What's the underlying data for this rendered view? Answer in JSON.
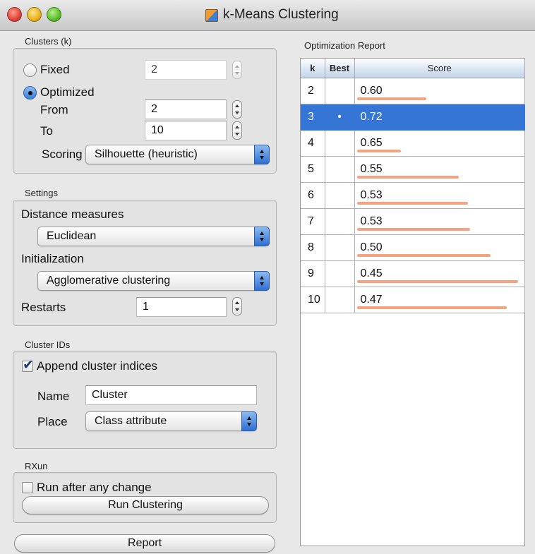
{
  "window": {
    "title": "k-Means Clustering"
  },
  "clusters": {
    "group_label": "Clusters (k)",
    "fixed_label": "Fixed",
    "fixed_value": "2",
    "optimized_label": "Optimized",
    "selected_mode": "Optimized",
    "from_label": "From",
    "from_value": "2",
    "to_label": "To",
    "to_value": "10",
    "scoring_label": "Scoring",
    "scoring_value": "Silhouette (heuristic)"
  },
  "settings": {
    "group_label": "Settings",
    "distance_label": "Distance measures",
    "distance_value": "Euclidean",
    "init_label": "Initialization",
    "init_value": "Agglomerative clustering",
    "restarts_label": "Restarts",
    "restarts_value": "1"
  },
  "cluster_ids": {
    "group_label": "Cluster IDs",
    "append_label": "Append cluster indices",
    "append_checked": true,
    "name_label": "Name",
    "name_value": "Cluster",
    "place_label": "Place",
    "place_value": "Class attribute"
  },
  "run": {
    "group_label": "RXun",
    "auto_label": "Run after any change",
    "auto_checked": false,
    "run_button": "Run Clustering"
  },
  "report_button": "Report",
  "optimization_report": {
    "label": "Optimization Report",
    "columns": [
      "k",
      "Best",
      "Score"
    ],
    "bar_color": "#f3a37f",
    "selected_color": "#3575d6",
    "rows": [
      {
        "k": "2",
        "best": "",
        "score": "0.60",
        "bar": 0.43,
        "selected": false
      },
      {
        "k": "3",
        "best": "•",
        "score": "0.72",
        "bar": 0.0,
        "selected": true
      },
      {
        "k": "4",
        "best": "",
        "score": "0.65",
        "bar": 0.27,
        "selected": false
      },
      {
        "k": "5",
        "best": "",
        "score": "0.55",
        "bar": 0.63,
        "selected": false
      },
      {
        "k": "6",
        "best": "",
        "score": "0.53",
        "bar": 0.69,
        "selected": false
      },
      {
        "k": "7",
        "best": "",
        "score": "0.53",
        "bar": 0.7,
        "selected": false
      },
      {
        "k": "8",
        "best": "",
        "score": "0.50",
        "bar": 0.83,
        "selected": false
      },
      {
        "k": "9",
        "best": "",
        "score": "0.45",
        "bar": 1.0,
        "selected": false
      },
      {
        "k": "10",
        "best": "",
        "score": "0.47",
        "bar": 0.93,
        "selected": false
      }
    ]
  }
}
